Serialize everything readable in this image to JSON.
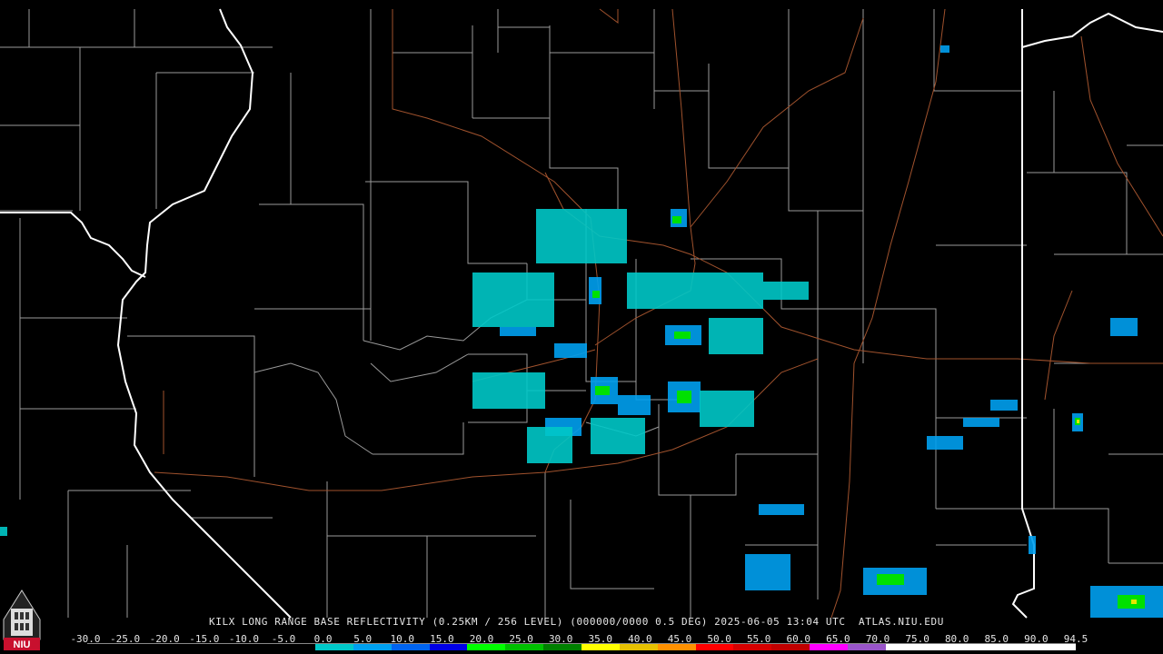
{
  "caption": "KILX LONG RANGE BASE REFLECTIVITY (0.25KM / 256 LEVEL) (000000/0000 0.5 DEG) 2025-06-05 13:04 UTC  ATLAS.NIU.EDU",
  "logo": {
    "icon": "niu-logo",
    "text": "NIU"
  },
  "scale": {
    "labels": [
      "-30.0",
      "-25.0",
      "-20.0",
      "-15.0",
      "-10.0",
      "-5.0",
      "0.0",
      "5.0",
      "10.0",
      "15.0",
      "20.0",
      "25.0",
      "30.0",
      "35.0",
      "40.0",
      "45.0",
      "50.0",
      "55.0",
      "60.0",
      "65.0",
      "70.0",
      "75.0",
      "80.0",
      "85.0",
      "90.0",
      "94.5"
    ],
    "colors": [
      "#000000",
      "#000000",
      "#000000",
      "#000000",
      "#000000",
      "#000000",
      "#00c8c8",
      "#00a0f0",
      "#0064f0",
      "#0000e6",
      "#00ff00",
      "#00c000",
      "#008000",
      "#ffff00",
      "#e6c000",
      "#ff9000",
      "#ff0000",
      "#d60000",
      "#c00000",
      "#ff00ff",
      "#9955c9",
      "#ffffff",
      "#ffffff",
      "#ffffff",
      "#ffffff",
      "#ffffff"
    ]
  },
  "colors": {
    "state_border": "#ffffff",
    "county_border": "#9a9a9a",
    "highway": "#a0522d",
    "background": "#000000"
  }
}
